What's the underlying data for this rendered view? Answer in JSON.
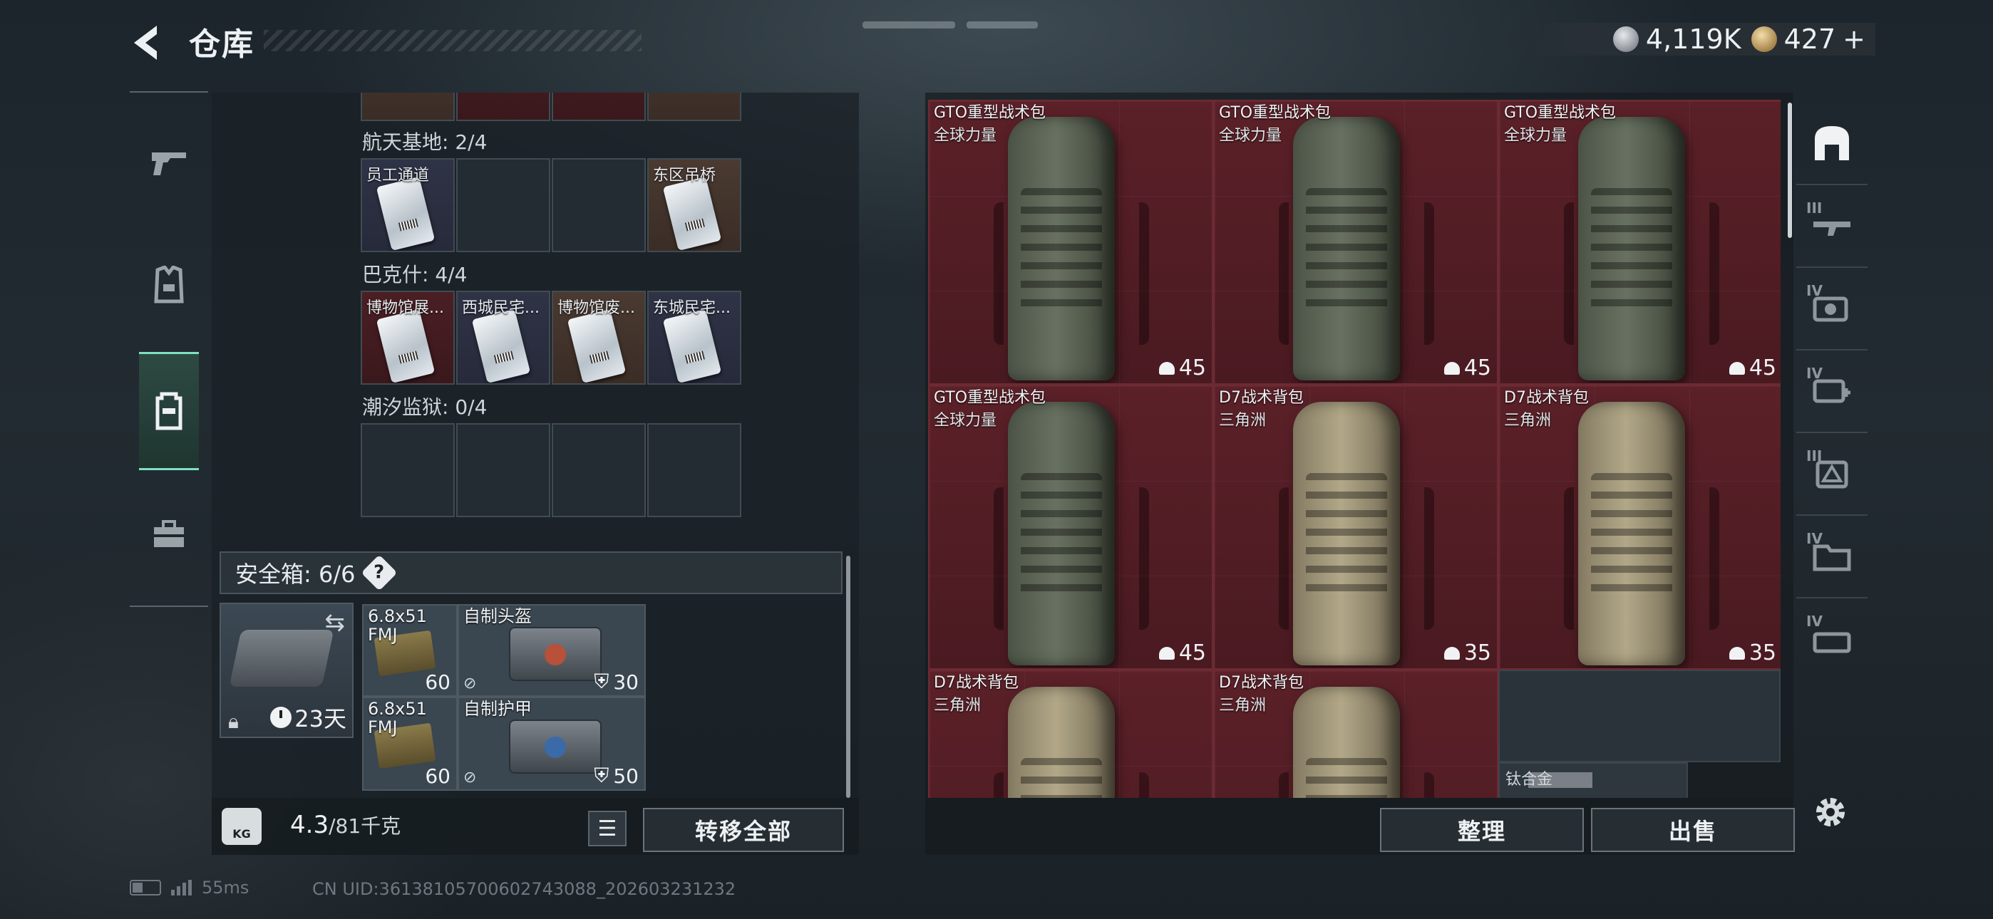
{
  "header": {
    "title": "仓库",
    "currency_silver": "4,119K",
    "currency_gold": "427",
    "currency_add": "+"
  },
  "left_rail": {
    "tabs": [
      {
        "name": "weapons-tab",
        "icon": "pistol-icon"
      },
      {
        "name": "equipment-tab",
        "icon": "armor-vest-icon"
      },
      {
        "name": "backpack-tab",
        "icon": "backpack-icon",
        "active": true
      },
      {
        "name": "toolbox-tab",
        "icon": "toolbox-icon"
      }
    ]
  },
  "keycard_case": {
    "maps": [
      {
        "label": "航天基地: 2/4",
        "cells": [
          {
            "label": "员工通道",
            "style": "blue",
            "has_item": true
          },
          {
            "label": "",
            "style": "empty",
            "has_item": false
          },
          {
            "label": "",
            "style": "empty",
            "has_item": false
          },
          {
            "label": "东区吊桥",
            "style": "brown",
            "has_item": true
          }
        ]
      },
      {
        "label": "巴克什: 4/4",
        "cells": [
          {
            "label": "博物馆展...",
            "style": "red",
            "has_item": true
          },
          {
            "label": "西城民宅...",
            "style": "blue",
            "has_item": true
          },
          {
            "label": "博物馆废...",
            "style": "brown",
            "has_item": true
          },
          {
            "label": "东城民宅...",
            "style": "blue",
            "has_item": true
          }
        ]
      },
      {
        "label": "潮汐监狱: 0/4",
        "cells": [
          {
            "label": "",
            "style": "empty",
            "has_item": false
          },
          {
            "label": "",
            "style": "empty",
            "has_item": false
          },
          {
            "label": "",
            "style": "empty",
            "has_item": false
          },
          {
            "label": "",
            "style": "empty",
            "has_item": false
          }
        ]
      }
    ]
  },
  "safe_box": {
    "title": "安全箱:",
    "count": "6/6",
    "help": "?",
    "timer": "23天",
    "items": [
      {
        "label": "6.8x51 FMJ",
        "count": "60"
      },
      {
        "label": "自制头盔",
        "durability": "30"
      },
      {
        "label": "6.8x51 FMJ",
        "count": "60"
      },
      {
        "label": "自制护甲",
        "durability": "50"
      }
    ]
  },
  "weight": {
    "current": "4.3",
    "max": "/81千克",
    "icon_label": "KG"
  },
  "transfer_all_label": "转移全部",
  "stash": {
    "items": [
      {
        "name": "GTO重型战术包",
        "sub": "全球力量",
        "capacity": "45",
        "color": "green"
      },
      {
        "name": "GTO重型战术包",
        "sub": "全球力量",
        "capacity": "45",
        "color": "green"
      },
      {
        "name": "GTO重型战术包",
        "sub": "全球力量",
        "capacity": "45",
        "color": "green"
      },
      {
        "name": "GTO重型战术包",
        "sub": "全球力量",
        "capacity": "45",
        "color": "green"
      },
      {
        "name": "D7战术背包",
        "sub": "三角洲",
        "capacity": "35",
        "color": "tan"
      },
      {
        "name": "D7战术背包",
        "sub": "三角洲",
        "capacity": "35",
        "color": "tan"
      },
      {
        "name": "D7战术背包",
        "sub": "三角洲",
        "capacity": "",
        "color": "tan"
      },
      {
        "name": "D7战术背包",
        "sub": "三角洲",
        "capacity": "",
        "color": "tan"
      }
    ],
    "partial_item_label": "钛合金",
    "sort_label": "整理",
    "sell_label": "出售"
  },
  "category_rail": [
    {
      "tier": "",
      "icon": "vault-icon",
      "active": true
    },
    {
      "tier": "III",
      "icon": "rifle-icon"
    },
    {
      "tier": "IV",
      "icon": "camera-icon"
    },
    {
      "tier": "IV",
      "icon": "medkit-icon"
    },
    {
      "tier": "III",
      "icon": "warning-device-icon"
    },
    {
      "tier": "IV",
      "icon": "folder-icon"
    },
    {
      "tier": "IV",
      "icon": "case-icon"
    }
  ],
  "status": {
    "ping": "55ms",
    "uid": "CN UID:36138105700602743088_202603231232"
  }
}
